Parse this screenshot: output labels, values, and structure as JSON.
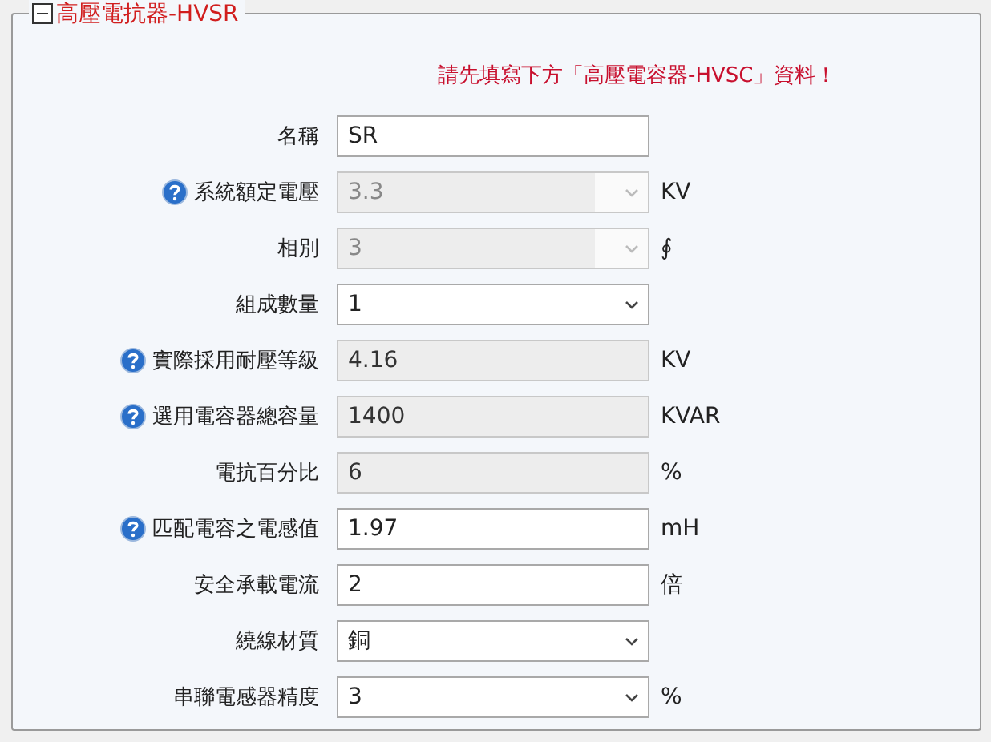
{
  "panel": {
    "title": "高壓電抗器-HVSR",
    "expanded": true,
    "notice": "請先填寫下方「高壓電容器-HVSC」資料！"
  },
  "fields": [
    {
      "label": "名稱",
      "help": false,
      "kind": "text",
      "value": "SR",
      "disabled": false
    },
    {
      "label": "系統額定電壓",
      "help": true,
      "kind": "select",
      "value": "3.3",
      "disabled": true,
      "unit": "KV"
    },
    {
      "label": "相別",
      "help": false,
      "kind": "select",
      "value": "3",
      "disabled": true,
      "unit": "∮"
    },
    {
      "label": "組成數量",
      "help": false,
      "kind": "select",
      "value": "1",
      "disabled": false
    },
    {
      "label": "實際採用耐壓等級",
      "help": true,
      "kind": "text",
      "value": "4.16",
      "disabled": true,
      "unit": "KV"
    },
    {
      "label": "選用電容器總容量",
      "help": true,
      "kind": "text",
      "value": "1400",
      "disabled": true,
      "unit": "KVAR"
    },
    {
      "label": "電抗百分比",
      "help": false,
      "kind": "text",
      "value": "6",
      "disabled": true,
      "unit": "%"
    },
    {
      "label": "匹配電容之電感值",
      "help": true,
      "kind": "text",
      "value": "1.97",
      "disabled": false,
      "unit": "mH"
    },
    {
      "label": "安全承載電流",
      "help": false,
      "kind": "text",
      "value": "2",
      "disabled": false,
      "unit": "倍"
    },
    {
      "label": "繞線材質",
      "help": false,
      "kind": "select",
      "value": "銅",
      "disabled": false
    },
    {
      "label": "串聯電感器精度",
      "help": false,
      "kind": "select",
      "value": "3",
      "disabled": false,
      "unit": "%"
    }
  ]
}
